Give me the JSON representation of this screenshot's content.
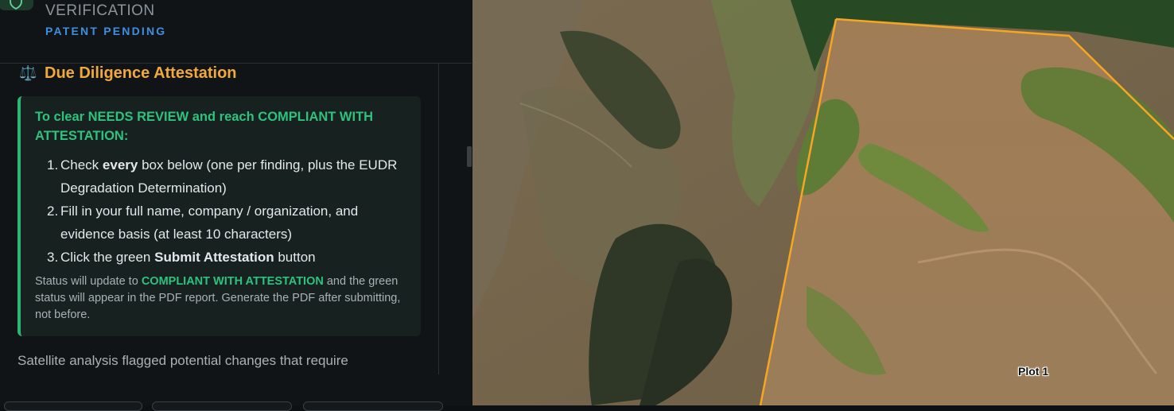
{
  "header": {
    "verification": "VERIFICATION",
    "patent": "PATENT PENDING",
    "logo_icon": "shield-icon"
  },
  "attestation": {
    "title": "Due Diligence Attestation",
    "title_icon": "balance-scale-icon",
    "heading": "To clear NEEDS REVIEW and reach COMPLIANT WITH ATTESTATION:",
    "steps": [
      {
        "num": "1.",
        "pre": "Check ",
        "bold": "every",
        "post": " box below (one per finding, plus the EUDR Degradation Determination)"
      },
      {
        "num": "2.",
        "pre": "Fill in your full name, company / organization, and evidence basis (at least 10 characters)",
        "bold": "",
        "post": ""
      },
      {
        "num": "3.",
        "pre": "Click the green ",
        "bold": "Submit Attestation",
        "post": " button"
      }
    ],
    "note_pre": "Status will update to ",
    "note_hl": "COMPLIANT WITH ATTESTATION",
    "note_post": " and the green status will appear in the PDF report. Generate the PDF after submitting, not before."
  },
  "satellite_text": "Satellite analysis flagged potential changes that require",
  "map": {
    "plot_label": "Plot 1",
    "boundary_color": "#f5a623"
  },
  "colors": {
    "accent_orange": "#f2a93b",
    "accent_green": "#2ec27e",
    "link_blue": "#3d8fe0"
  }
}
